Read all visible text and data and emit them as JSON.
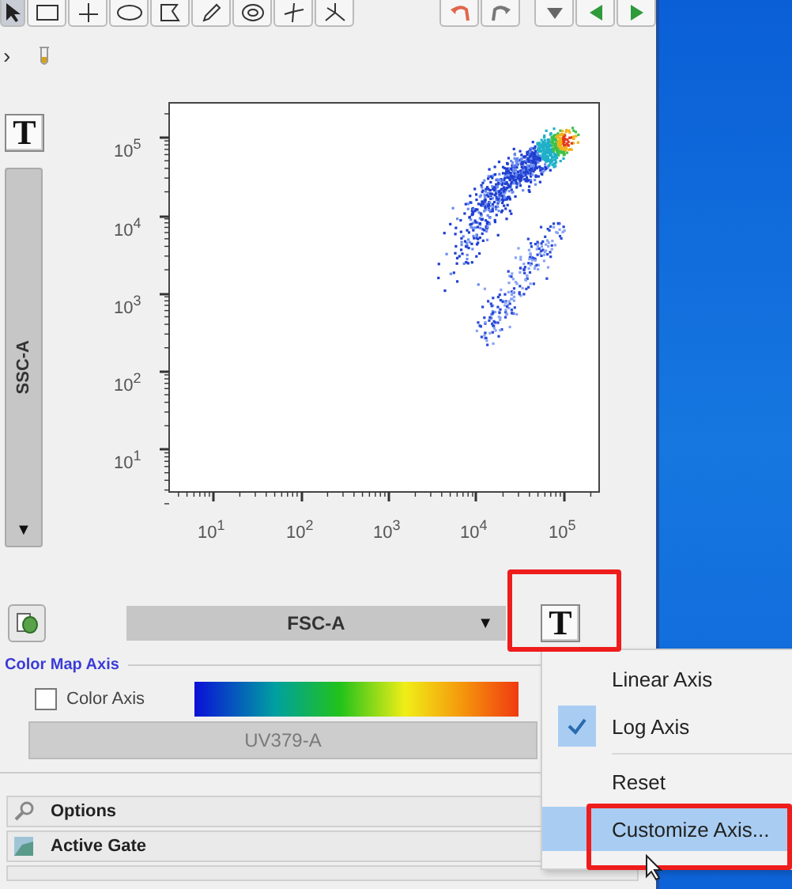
{
  "tree": {
    "toggle": "›"
  },
  "y_axis": {
    "button": "T",
    "label": "SSC-A",
    "arrow": "▼",
    "ticks": [
      "10$^{5}$",
      "10$^{4}$",
      "10$^{3}$",
      "10$^{2}$",
      "10$^{1}$"
    ]
  },
  "x_axis": {
    "button": "T",
    "label": "FSC-A",
    "arrow": "▼",
    "ticks": [
      "10$^{1}$",
      "10$^{2}$",
      "10$^{3}$",
      "10$^{4}$",
      "10$^{5}$"
    ]
  },
  "color_map": {
    "title": "Color Map Axis",
    "checkbox": {
      "label": "Color Axis",
      "checked": false
    },
    "parameter": "UV379-A",
    "disabled": true
  },
  "sections": [
    {
      "label": "Options",
      "kind": "search"
    },
    {
      "label": "Active Gate",
      "kind": "gate"
    }
  ],
  "context_menu": {
    "items": [
      {
        "kind": "item",
        "label": "Linear Axis",
        "checked": false,
        "selected": false
      },
      {
        "kind": "item",
        "label": "Log Axis",
        "checked": true,
        "selected": false
      },
      {
        "kind": "separator"
      },
      {
        "kind": "item",
        "label": "Reset",
        "checked": false,
        "selected": false
      },
      {
        "kind": "item",
        "label": "Customize Axis...",
        "checked": false,
        "selected": true
      }
    ]
  }
}
